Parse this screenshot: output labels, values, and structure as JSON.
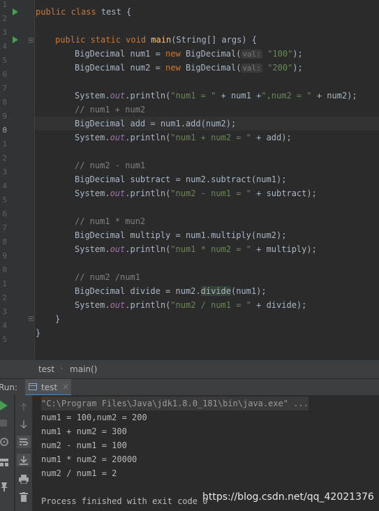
{
  "editor": {
    "line_numbers": [
      "1",
      "2",
      "3",
      "4",
      "5",
      "6",
      "7",
      "8",
      "9",
      "0",
      "1",
      "2",
      "3",
      "4",
      "5",
      "6",
      "7",
      "8",
      "9",
      "0",
      "1",
      "2",
      "3",
      "4",
      "5"
    ],
    "current_line_index": 8
  },
  "code": {
    "l11": {
      "k1": "public class ",
      "name": "test {"
    },
    "l13": {
      "k1": "public static void ",
      "fn": "main",
      "rest": "(String[] args) {"
    },
    "l14": {
      "a": "BigDecimal num1 = ",
      "kw": "new ",
      "b": "BigDecimal(",
      "hint": "val:",
      "s": "\"100\"",
      "c": ");"
    },
    "l15": {
      "a": "BigDecimal num2 = ",
      "kw": "new ",
      "b": "BigDecimal(",
      "hint": "val:",
      "s": "\"200\"",
      "c": ");"
    },
    "l17": {
      "a": "System.",
      "fld": "out",
      "b": ".println(",
      "s1": "\"num1 = \"",
      "c": " + num1 +",
      "s2": "\",num2 = \"",
      "d": " + num2);"
    },
    "l18": {
      "cm": "// num1 + num2"
    },
    "l19": {
      "a": "BigDecimal add = num1.add(num2);"
    },
    "l20": {
      "a": "System.",
      "fld": "out",
      "b": ".println(",
      "s": "\"num1 + num2 = \"",
      "c": " + add);"
    },
    "l22": {
      "cm": "// num2 - num1"
    },
    "l23": {
      "a": "BigDecimal subtract = num2.subtract(num1);"
    },
    "l24": {
      "a": "System.",
      "fld": "out",
      "b": ".println(",
      "s": "\"num2 - num1 = \"",
      "c": " + subtract);"
    },
    "l26": {
      "cm": "// num1 * mun2"
    },
    "l27": {
      "a": "BigDecimal multiply = num1.multiply(num2);"
    },
    "l28": {
      "a": "System.",
      "fld": "out",
      "b": ".println(",
      "s": "\"num1 * num2 = \"",
      "c": " + multiply);"
    },
    "l30": {
      "cm": "// num2 /num1"
    },
    "l31": {
      "a": "BigDecimal divide = num2.",
      "hl": "divide",
      "c": "(num1);"
    },
    "l32": {
      "a": "System.",
      "fld": "out",
      "b": ".println(",
      "s": "\"num2 / num1 = \"",
      "c": " + divide);"
    },
    "l33": {
      "a": "}"
    },
    "l34": {
      "a": "}"
    }
  },
  "breadcrumb": {
    "items": [
      "test",
      "main()"
    ]
  },
  "run_panel": {
    "label": "Run:",
    "tab_label": "test",
    "tab_close": "×"
  },
  "console": {
    "command": "\"C:\\Program Files\\Java\\jdk1.8.0_181\\bin\\java.exe\" ...",
    "lines": [
      "num1 = 100,num2 = 200",
      "num1 + num2 = 300",
      "num2 - num1 = 100",
      "num1 * num2 = 20000",
      "num2 / num1 = 2"
    ],
    "exit": "Process finished with exit code 0"
  },
  "watermark": "https://blog.csdn.net/qq_42021376",
  "colors": {
    "accent": "#4a88c7",
    "run_green": "#499c54",
    "keyword": "#cc7832",
    "string": "#6a8759"
  }
}
